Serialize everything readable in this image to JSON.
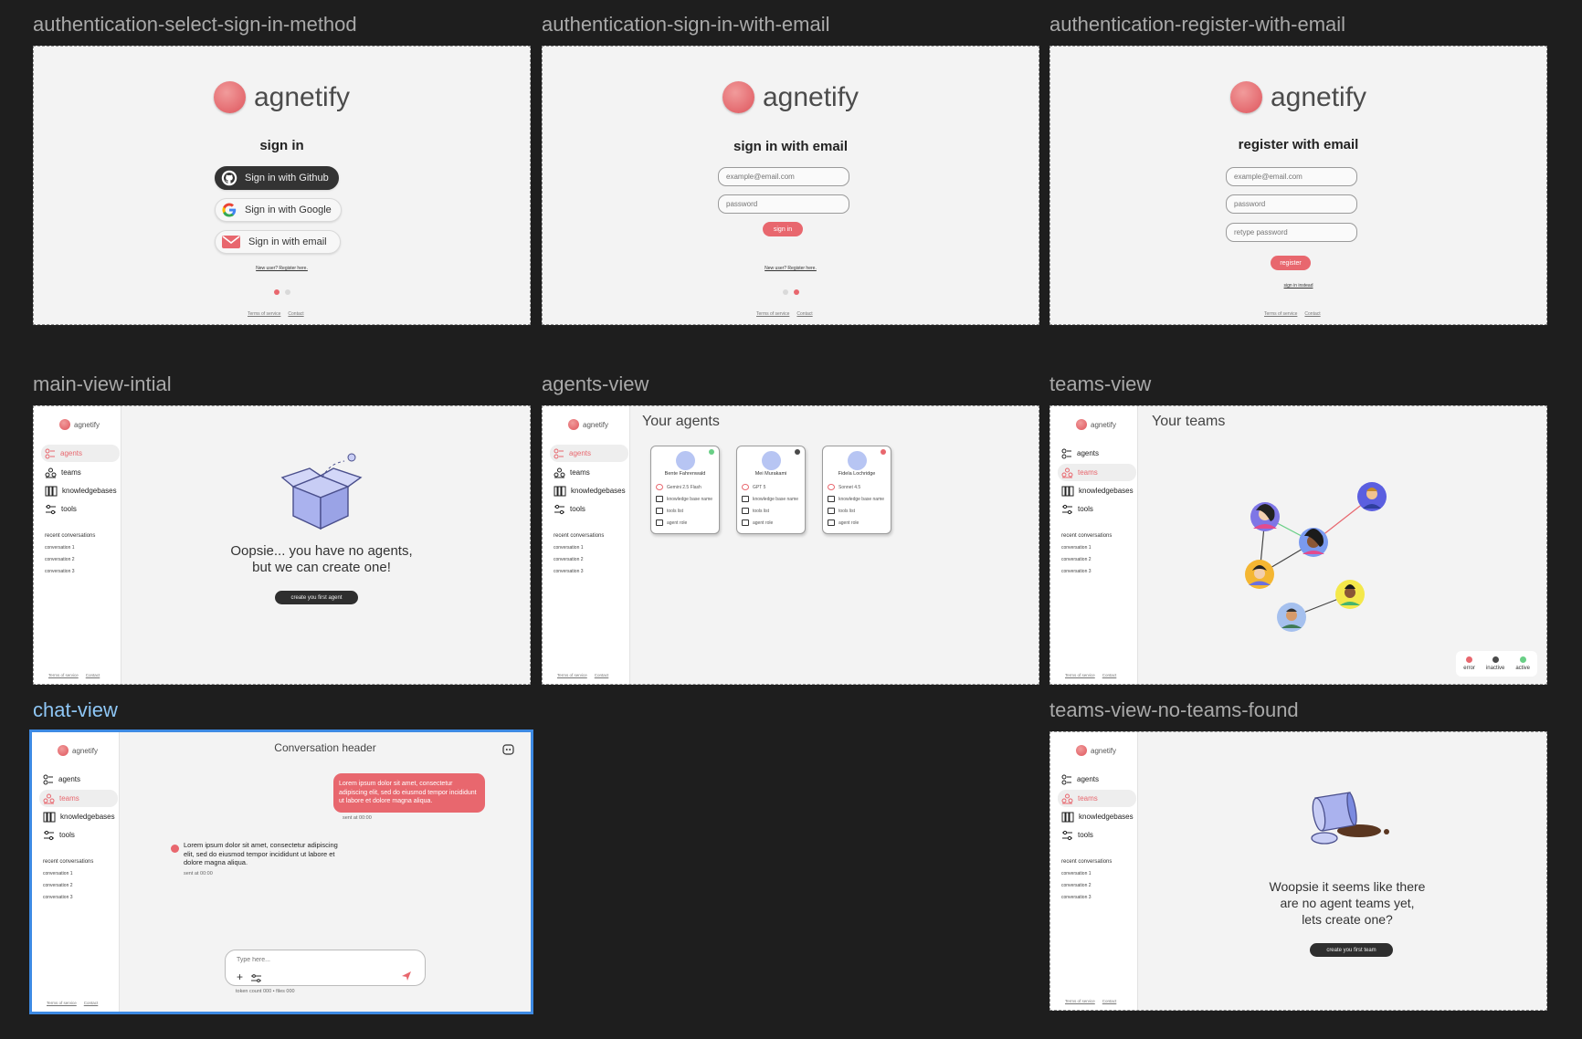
{
  "frames": {
    "select_sign_in": "authentication-select-sign-in-method",
    "sign_in_email": "authentication-sign-in-with-email",
    "register_email": "authentication-register-with-email",
    "main_initial": "main-view-intial",
    "agents_view": "agents-view",
    "teams_view": "teams-view",
    "chat_view": "chat-view",
    "teams_no_teams": "teams-view-no-teams-found"
  },
  "brand": {
    "name": "agnetify",
    "accent": "#e8676e"
  },
  "auth": {
    "sign_in_title": "sign in",
    "github_label": "Sign in with Github",
    "google_label": "Sign in with Google",
    "email_label": "Sign in with email",
    "new_user_link": "New user? Register here.",
    "sign_in_email_title": "sign in with email",
    "email_placeholder": "example@email.com",
    "password_placeholder": "password",
    "retype_placeholder": "retype password",
    "sign_in_button": "sign in",
    "register_title": "register with email",
    "register_button": "register",
    "sign_in_instead": "sign in instead",
    "terms": "Terms of service",
    "contact": "Contact"
  },
  "sidebar": {
    "items": [
      {
        "label": "agents",
        "icon": "agents-icon"
      },
      {
        "label": "teams",
        "icon": "teams-icon"
      },
      {
        "label": "knowledgebases",
        "icon": "books-icon"
      },
      {
        "label": "tools",
        "icon": "sliders-icon"
      }
    ],
    "recent_title": "recent conversations",
    "recent": [
      "conversation 1",
      "conversation 2",
      "conversation 3"
    ],
    "terms": "Terms of service",
    "contact": "Contact"
  },
  "main_initial": {
    "message_line1": "Oopsie... you have no agents,",
    "message_line2": "but we can create one!",
    "create_button": "create you first agent"
  },
  "agents_view": {
    "title": "Your agents",
    "cards": [
      {
        "name": "Bente Fahrenwald",
        "model": "Gemini 2.5 Flash",
        "kb": "knowledge base name",
        "tools": "tools list",
        "role": "agent role",
        "status_color": "#69cf86"
      },
      {
        "name": "Mei Murakami",
        "model": "GPT 5",
        "kb": "knowledge base name",
        "tools": "tools list",
        "role": "agent role",
        "status_color": "#4a4a4a"
      },
      {
        "name": "Fidela Lochridge",
        "model": "Sonnet 4.5",
        "kb": "knowledge base name",
        "tools": "tools list",
        "role": "agent role",
        "status_color": "#e8676e"
      }
    ]
  },
  "teams_view": {
    "title": "Your teams",
    "legend": [
      {
        "label": "error",
        "color": "#e8676e"
      },
      {
        "label": "inactive",
        "color": "#4a4a4a"
      },
      {
        "label": "active",
        "color": "#69cf86"
      }
    ]
  },
  "chat_view": {
    "header": "Conversation header",
    "user_message": "Lorem ipsum dolor sit amet, consectetur adipiscing elit, sed do eiusmod tempor incididunt ut labore et dolore magna aliqua.",
    "user_sent": "sent at 00:00",
    "bot_message": "Lorem ipsum dolor sit amet, consectetur adipiscing elit, sed do eiusmod tempor incididunt ut labore et dolore magna aliqua.",
    "bot_sent": "sent at 00:00",
    "input_placeholder": "Type here...",
    "token_info": "token count 000 • files 000"
  },
  "teams_no_teams": {
    "line1": "Woopsie it seems like there",
    "line2": "are no agent teams yet,",
    "line3": "lets create one?",
    "create_button": "create you first team"
  }
}
